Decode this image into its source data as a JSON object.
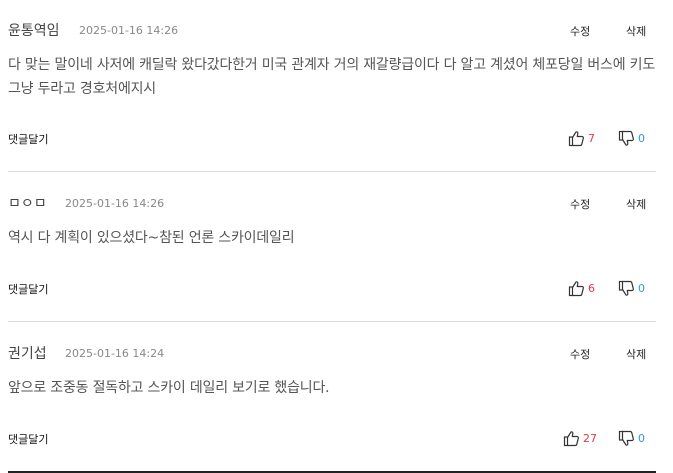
{
  "actions": {
    "edit_label": "수정",
    "delete_label": "삭제",
    "reply_label": "댓글달기"
  },
  "comments": [
    {
      "author": "윤통역임",
      "date": "2025-01-16 14:26",
      "text": "다 맞는 말이네 사저에 캐딜락 왔다갔다한거 미국 관계자 거의 재갈량급이다 다 알고 계셨어 체포당일 버스에 키도 그냥 두라고 경호처에지시",
      "likes": "7",
      "dislikes": "0"
    },
    {
      "author": "ㅁㅇㅁ",
      "date": "2025-01-16 14:26",
      "text": "역시 다 계획이 있으셨다~참된 언론 스카이데일리",
      "likes": "6",
      "dislikes": "0"
    },
    {
      "author": "권기섭",
      "date": "2025-01-16 14:24",
      "text": "앞으로 조중동 절독하고 스카이 데일리 보기로 했습니다.",
      "likes": "27",
      "dislikes": "0"
    }
  ],
  "colors": {
    "like_count": "#e0384f",
    "dislike_count": "#2d9bd6",
    "divider": "#dddddd"
  },
  "icons": {
    "like": "thumbs-up-icon",
    "dislike": "thumbs-down-icon"
  }
}
